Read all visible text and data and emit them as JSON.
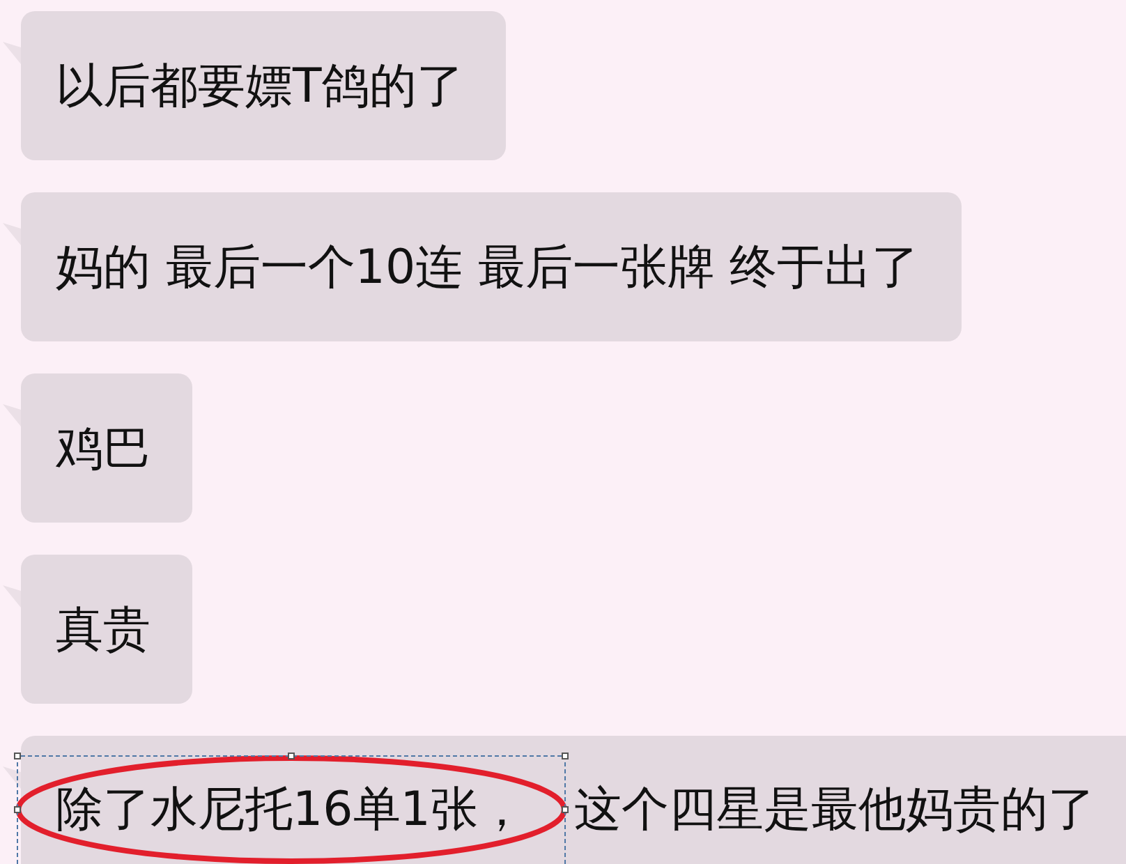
{
  "messages": [
    {
      "text": "以后都要嫖T鸽的了"
    },
    {
      "text": "妈的 最后一个10连 最后一张牌 终于出了"
    },
    {
      "text": "鸡巴"
    },
    {
      "text": "真贵"
    },
    {
      "parts": [
        {
          "text": "除了水尼托16单1张，",
          "annotation": {
            "kind": "ellipse",
            "selected": true
          }
        },
        {
          "text": "这个四星是最他妈贵的了"
        }
      ]
    }
  ]
}
